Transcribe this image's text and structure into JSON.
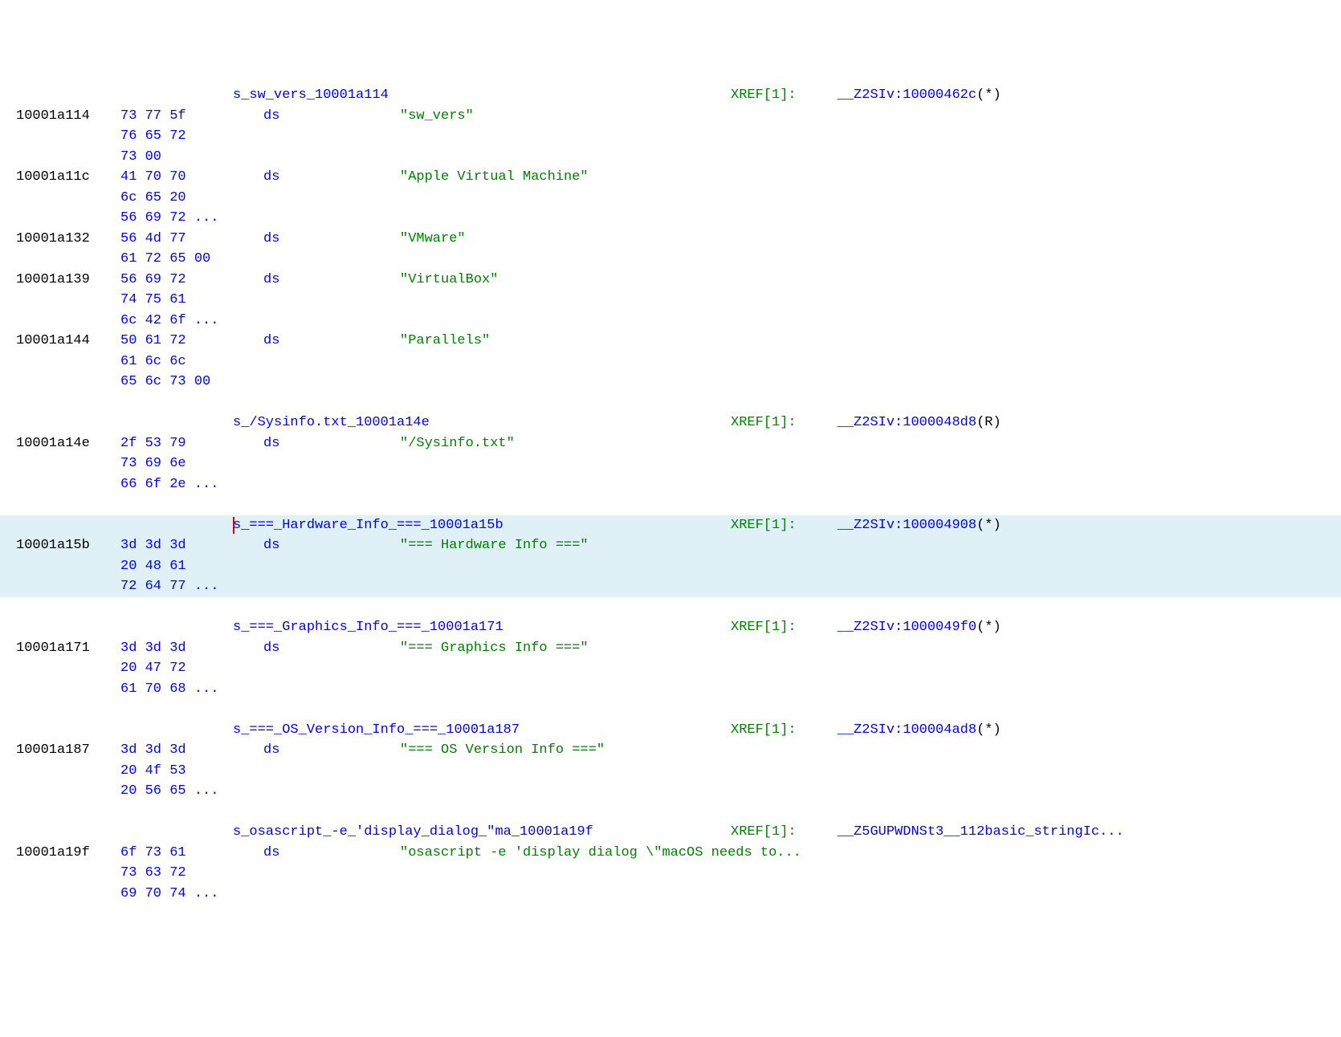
{
  "entries": [
    {
      "label": "s_sw_vers_10001a114",
      "addr": "10001a114",
      "bytes": [
        "73 77 5f",
        "76 65 72",
        "73 00"
      ],
      "op": "ds",
      "value": "\"sw_vers\"",
      "xref_key": "XREF[1]:",
      "xref_sym": "__Z2SIv:10000462c",
      "xref_suffix": "(*)"
    },
    {
      "label": "",
      "addr": "10001a11c",
      "bytes": [
        "41 70 70",
        "6c 65 20",
        "56 69 72 ..."
      ],
      "op": "ds",
      "value": "\"Apple Virtual Machine\"",
      "xref_key": "",
      "xref_sym": "",
      "xref_suffix": ""
    },
    {
      "label": "",
      "addr": "10001a132",
      "bytes": [
        "56 4d 77",
        "61 72 65 00"
      ],
      "op": "ds",
      "value": "\"VMware\"",
      "xref_key": "",
      "xref_sym": "",
      "xref_suffix": ""
    },
    {
      "label": "",
      "addr": "10001a139",
      "bytes": [
        "56 69 72",
        "74 75 61",
        "6c 42 6f ..."
      ],
      "op": "ds",
      "value": "\"VirtualBox\"",
      "xref_key": "",
      "xref_sym": "",
      "xref_suffix": ""
    },
    {
      "label": "",
      "addr": "10001a144",
      "bytes": [
        "50 61 72",
        "61 6c 6c",
        "65 6c 73 00"
      ],
      "op": "ds",
      "value": "\"Parallels\"",
      "xref_key": "",
      "xref_sym": "",
      "xref_suffix": ""
    },
    {
      "spacer": true
    },
    {
      "label": "s_/Sysinfo.txt_10001a14e",
      "addr": "10001a14e",
      "bytes": [
        "2f 53 79",
        "73 69 6e",
        "66 6f 2e ..."
      ],
      "op": "ds",
      "value": "\"/Sysinfo.txt\"",
      "xref_key": "XREF[1]:",
      "xref_sym": "__Z2SIv:1000048d8",
      "xref_suffix": "(R)"
    },
    {
      "spacer": true
    },
    {
      "highlight": true,
      "cursor": true,
      "label": "s_===_Hardware_Info_===_10001a15b",
      "addr": "10001a15b",
      "bytes": [
        "3d 3d 3d",
        "20 48 61",
        "72 64 77 ..."
      ],
      "op": "ds",
      "value": "\"=== Hardware Info ===\"",
      "xref_key": "XREF[1]:",
      "xref_sym": "__Z2SIv:100004908",
      "xref_suffix": "(*)"
    },
    {
      "spacer": true
    },
    {
      "label": "s_===_Graphics_Info_===_10001a171",
      "addr": "10001a171",
      "bytes": [
        "3d 3d 3d",
        "20 47 72",
        "61 70 68 ..."
      ],
      "op": "ds",
      "value": "\"=== Graphics Info ===\"",
      "xref_key": "XREF[1]:",
      "xref_sym": "__Z2SIv:1000049f0",
      "xref_suffix": "(*)"
    },
    {
      "spacer": true
    },
    {
      "label": "s_===_OS_Version_Info_===_10001a187",
      "addr": "10001a187",
      "bytes": [
        "3d 3d 3d",
        "20 4f 53",
        "20 56 65 ..."
      ],
      "op": "ds",
      "value": "\"=== OS Version Info ===\"",
      "xref_key": "XREF[1]:",
      "xref_sym": "__Z2SIv:100004ad8",
      "xref_suffix": "(*)"
    },
    {
      "spacer": true
    },
    {
      "label": "s_osascript_-e_'display_dialog_\"ma_10001a19f",
      "addr": "10001a19f",
      "bytes": [
        "6f 73 61",
        "73 63 72",
        "69 70 74 ..."
      ],
      "op": "ds",
      "value": "\"osascript -e 'display dialog \\\"macOS needs to...",
      "xref_key": "XREF[1]:",
      "xref_sym": "__Z5GUPWDNSt3__112basic_stringIc...",
      "xref_suffix": ""
    }
  ]
}
